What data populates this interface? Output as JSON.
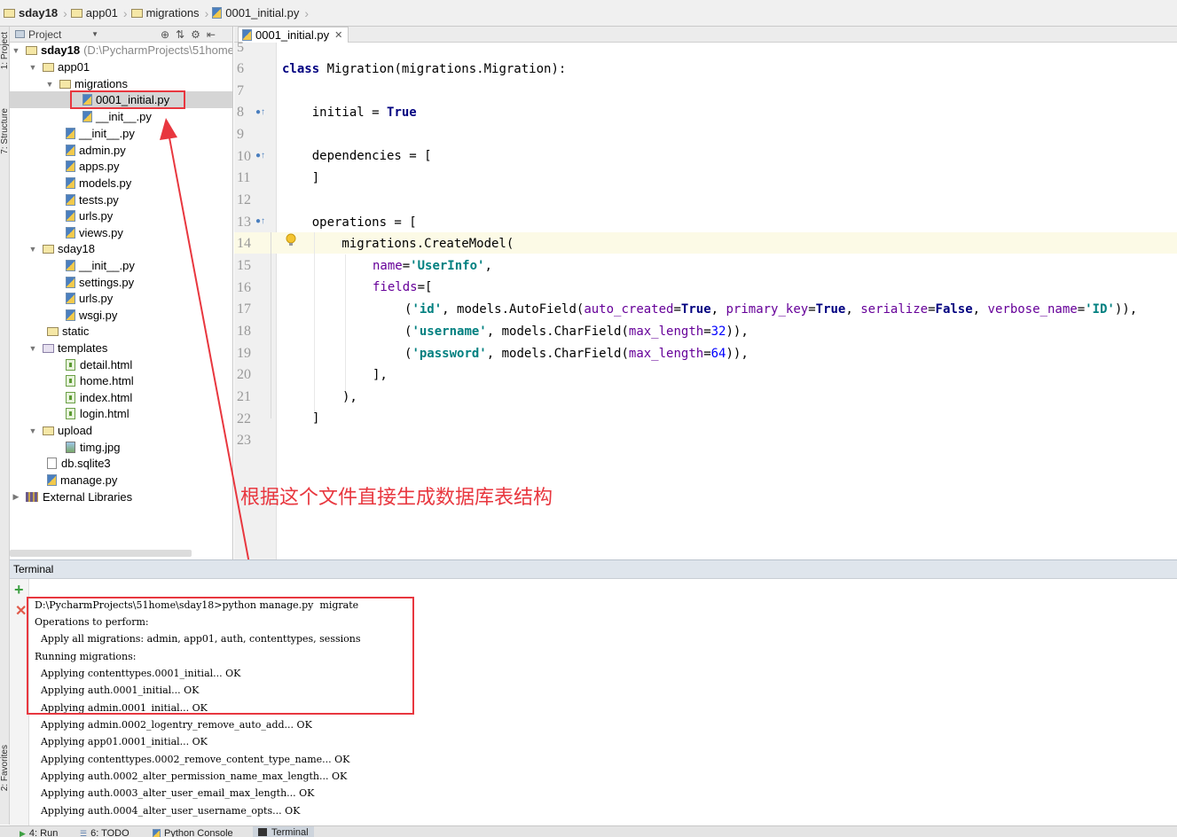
{
  "breadcrumb": [
    "sday18",
    "app01",
    "migrations",
    "0001_initial.py"
  ],
  "left_tool_tabs": [
    "1: Project",
    "7: Structure",
    "2: Favorites"
  ],
  "project_panel": {
    "view_selector": "Project",
    "tree": [
      {
        "label": "sday18",
        "path": "(D:\\PycharmProjects\\51home"
      },
      {
        "label": "app01"
      },
      {
        "label": "migrations"
      },
      {
        "label": "0001_initial.py"
      },
      {
        "label": "__init__.py"
      },
      {
        "label": "__init__.py"
      },
      {
        "label": "admin.py"
      },
      {
        "label": "apps.py"
      },
      {
        "label": "models.py"
      },
      {
        "label": "tests.py"
      },
      {
        "label": "urls.py"
      },
      {
        "label": "views.py"
      },
      {
        "label": "sday18"
      },
      {
        "label": "__init__.py"
      },
      {
        "label": "settings.py"
      },
      {
        "label": "urls.py"
      },
      {
        "label": "wsgi.py"
      },
      {
        "label": "static"
      },
      {
        "label": "templates"
      },
      {
        "label": "detail.html"
      },
      {
        "label": "home.html"
      },
      {
        "label": "index.html"
      },
      {
        "label": "login.html"
      },
      {
        "label": "upload"
      },
      {
        "label": "timg.jpg"
      },
      {
        "label": "db.sqlite3"
      },
      {
        "label": "manage.py"
      },
      {
        "label": "External Libraries"
      }
    ]
  },
  "editor": {
    "tab_label": "0001_initial.py",
    "line_numbers": [
      "5",
      "6",
      "7",
      "8",
      "9",
      "10",
      "11",
      "12",
      "13",
      "14",
      "15",
      "16",
      "17",
      "18",
      "19",
      "20",
      "21",
      "22",
      "23"
    ],
    "code": {
      "l6_kw": "class",
      "l6_rest": " Migration(migrations.Migration):",
      "l8_a": "    initial = ",
      "l8_b": "True",
      "l10": "    dependencies = [",
      "l11": "    ]",
      "l13": "    operations = [",
      "l14": "        migrations.CreateModel(",
      "l15_a": "name",
      "l15_b": "=",
      "l15_c": "'UserInfo'",
      "l15_d": ",",
      "l16_a": "fields",
      "l16_b": "=[",
      "l17_a": "(",
      "l17_b": "'id'",
      "l17_c": ", models.AutoField(",
      "l17_d": "auto_created",
      "l17_e": "=",
      "l17_f": "True",
      "l17_g": ", ",
      "l17_h": "primary_key",
      "l17_i": "=",
      "l17_j": "True",
      "l17_k": ", ",
      "l17_l": "serialize",
      "l17_m": "=",
      "l17_n": "False",
      "l17_o": ", ",
      "l17_p": "verbose_name",
      "l17_q": "=",
      "l17_r": "'ID'",
      "l17_s": ")),",
      "l18_a": "(",
      "l18_b": "'username'",
      "l18_c": ", models.CharField(",
      "l18_d": "max_length",
      "l18_e": "=",
      "l18_f": "32",
      "l18_g": ")),",
      "l19_a": "(",
      "l19_b": "'password'",
      "l19_c": ", models.CharField(",
      "l19_d": "max_length",
      "l19_e": "=",
      "l19_f": "64",
      "l19_g": ")),",
      "l20": "],",
      "l21": "),",
      "l22": "]"
    }
  },
  "annotation": "根据这个文件直接生成数据库表结构",
  "terminal": {
    "title": "Terminal",
    "lines": [
      "D:\\PycharmProjects\\51home\\sday18>python manage.py  migrate",
      "Operations to perform:",
      "  Apply all migrations: admin, app01, auth, contenttypes, sessions",
      "Running migrations:",
      "  Applying contenttypes.0001_initial... OK",
      "  Applying auth.0001_initial... OK",
      "  Applying admin.0001_initial... OK",
      "  Applying admin.0002_logentry_remove_auto_add... OK",
      "  Applying app01.0001_initial... OK",
      "  Applying contenttypes.0002_remove_content_type_name... OK",
      "  Applying auth.0002_alter_permission_name_max_length... OK",
      "  Applying auth.0003_alter_user_email_max_length... OK",
      "  Applying auth.0004_alter_user_username_opts... OK"
    ]
  },
  "bottom_tabs": [
    "4: Run",
    "6: TODO",
    "Python Console",
    "Terminal"
  ],
  "colors": {
    "annotation": "#e8373f",
    "keyword": "#000080",
    "string": "#008080",
    "kwarg": "#660099",
    "number": "#0000ff"
  }
}
